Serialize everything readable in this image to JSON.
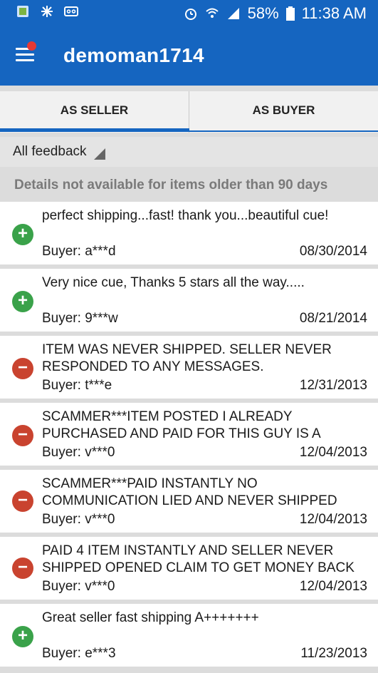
{
  "status_bar": {
    "battery": "58%",
    "time": "11:38 AM"
  },
  "app_bar": {
    "title": "demoman1714"
  },
  "tabs": [
    {
      "label": "AS SELLER",
      "selected": true
    },
    {
      "label": "AS BUYER",
      "selected": false
    }
  ],
  "filter": {
    "label": "All feedback"
  },
  "notice": "Details not available for items older than 90 days",
  "feedback": [
    {
      "type": "positive",
      "comment": "perfect shipping...fast!  thank you...beautiful cue!",
      "buyer": "Buyer: a***d",
      "date": "08/30/2014"
    },
    {
      "type": "positive",
      "comment": "Very nice cue, Thanks   5 stars all the way.....",
      "buyer": "Buyer: 9***w",
      "date": "08/21/2014"
    },
    {
      "type": "negative",
      "comment": "ITEM WAS NEVER SHIPPED. SELLER NEVER RESPONDED TO ANY MESSAGES.",
      "buyer": "Buyer: t***e",
      "date": "12/31/2013"
    },
    {
      "type": "negative",
      "comment": "SCAMMER***ITEM POSTED I ALREADY PURCHASED AND PAID FOR THIS GUY IS A",
      "buyer": "Buyer: v***0",
      "date": "12/04/2013"
    },
    {
      "type": "negative",
      "comment": "SCAMMER***PAID INSTANTLY NO COMMUNICATION LIED AND NEVER SHIPPED",
      "buyer": "Buyer: v***0",
      "date": "12/04/2013"
    },
    {
      "type": "negative",
      "comment": "PAID 4 ITEM INSTANTLY AND SELLER NEVER SHIPPED OPENED CLAIM TO GET MONEY BACK",
      "buyer": "Buyer: v***0",
      "date": "12/04/2013"
    },
    {
      "type": "positive",
      "comment": "Great seller fast shipping A+++++++",
      "buyer": "Buyer: e***3",
      "date": "11/23/2013"
    }
  ]
}
